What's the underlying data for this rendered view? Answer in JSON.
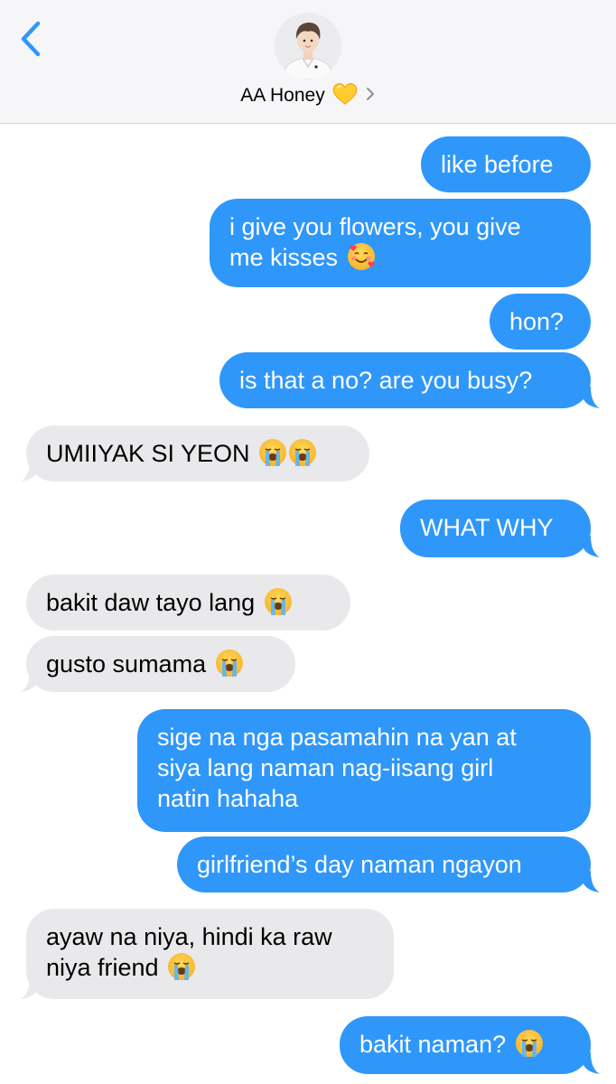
{
  "header": {
    "back_label": "Back",
    "contact_name": "AA Honey",
    "heart_emoji": "💛",
    "contact_chevron": "›",
    "accent_color": "#2f97fa"
  },
  "messages": [
    {
      "from": "me",
      "text": "like before"
    },
    {
      "from": "me",
      "text": "i give you flowers, you give",
      "text2": "me kisses",
      "emoji": "🥰"
    },
    {
      "from": "me",
      "text": "hon?"
    },
    {
      "from": "me",
      "text": "is that a no? are you busy?"
    },
    {
      "from": "them",
      "text": "UMIIYAK SI YEON",
      "emoji": "😭😭"
    },
    {
      "from": "me",
      "text": "WHAT WHY"
    },
    {
      "from": "them",
      "text": "bakit daw tayo lang",
      "emoji": "😭"
    },
    {
      "from": "them",
      "text": "gusto sumama",
      "emoji": "😭"
    },
    {
      "from": "me",
      "text": "sige na nga pasamahin na yan at",
      "text2": "siya lang naman nag-iisang girl",
      "text3": "natin hahaha"
    },
    {
      "from": "me",
      "text": "girlfriend’s day naman ngayon"
    },
    {
      "from": "them",
      "text": "ayaw na niya, hindi ka raw",
      "text2": "niya friend",
      "emoji": "😭"
    },
    {
      "from": "me",
      "text": "bakit naman?",
      "emoji": "😭"
    }
  ],
  "colors": {
    "sent_bubble": "#2f97fa",
    "received_bubble": "#e9e9ec",
    "header_bg": "#f6f6f8"
  }
}
